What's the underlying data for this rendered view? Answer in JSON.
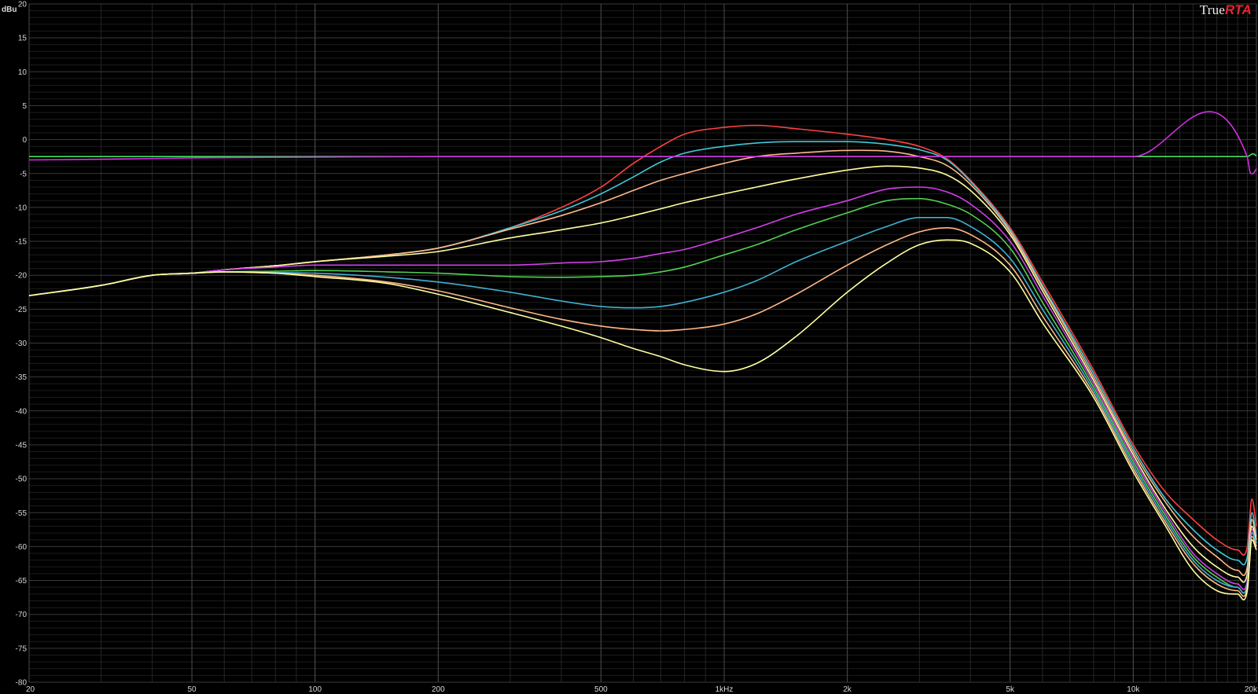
{
  "brand": {
    "prefix": "True",
    "accent": "RTA",
    "accent_color": "#e8232a"
  },
  "chart_data": {
    "type": "line",
    "ylabel": "dBu",
    "xscale": "log",
    "xlim": [
      20,
      20000
    ],
    "ylim": [
      -80,
      20
    ],
    "grid": true,
    "background": "#000000",
    "yticks": [
      20,
      15,
      10,
      5,
      0,
      -5,
      -10,
      -15,
      -20,
      -25,
      -30,
      -35,
      -40,
      -45,
      -50,
      -55,
      -60,
      -65,
      -70,
      -75,
      -80
    ],
    "xticks": [
      {
        "value": 20,
        "label": "20"
      },
      {
        "value": 50,
        "label": "50"
      },
      {
        "value": 100,
        "label": "100"
      },
      {
        "value": 200,
        "label": "200"
      },
      {
        "value": 500,
        "label": "500"
      },
      {
        "value": 1000,
        "label": "1kHz"
      },
      {
        "value": 2000,
        "label": "2k"
      },
      {
        "value": 5000,
        "label": "5k"
      },
      {
        "value": 10000,
        "label": "10k"
      },
      {
        "value": 20000,
        "label": "20k"
      }
    ],
    "series": [
      {
        "color": "#ff4040",
        "x": [
          20,
          30,
          40,
          50,
          60,
          80,
          100,
          150,
          200,
          300,
          400,
          500,
          600,
          700,
          800,
          1000,
          1200,
          1500,
          2000,
          2500,
          3000,
          3500,
          4000,
          5000,
          6000,
          8000,
          10000,
          12000,
          14000,
          16000,
          18000,
          19000,
          19500,
          20000
        ],
        "y": [
          -23,
          -21.5,
          -20,
          -19.7,
          -19.2,
          -18.6,
          -18,
          -17,
          -16,
          -13,
          -10,
          -7,
          -3.5,
          -1,
          0.8,
          1.8,
          2.1,
          1.6,
          0.8,
          0,
          -1,
          -2.8,
          -6,
          -13,
          -21,
          -34,
          -45,
          -52,
          -56,
          -59,
          -60.5,
          -60,
          -53,
          -57
        ]
      },
      {
        "color": "#40c8d8",
        "x": [
          20,
          30,
          40,
          50,
          60,
          80,
          100,
          150,
          200,
          300,
          400,
          500,
          600,
          700,
          800,
          1000,
          1200,
          1500,
          2000,
          2500,
          3000,
          3500,
          4000,
          5000,
          6000,
          8000,
          10000,
          12000,
          14000,
          16000,
          18000,
          19000,
          19500,
          20000
        ],
        "y": [
          -23,
          -21.5,
          -20,
          -19.7,
          -19.2,
          -18.6,
          -18,
          -17,
          -16,
          -13,
          -10.5,
          -8,
          -5.5,
          -3.3,
          -2,
          -1,
          -0.5,
          -0.3,
          -0.3,
          -0.7,
          -1.5,
          -3,
          -6.2,
          -13.3,
          -21.5,
          -34.5,
          -45.5,
          -53,
          -57.5,
          -60.5,
          -62,
          -61.5,
          -55,
          -58.5
        ]
      },
      {
        "color": "#ffb888",
        "x": [
          20,
          30,
          40,
          50,
          60,
          80,
          100,
          150,
          200,
          300,
          400,
          500,
          600,
          700,
          800,
          1000,
          1200,
          1500,
          2000,
          2500,
          3000,
          3500,
          4000,
          5000,
          6000,
          8000,
          10000,
          12000,
          14000,
          16000,
          18000,
          19000,
          19500,
          20000
        ],
        "y": [
          -23,
          -21.5,
          -20,
          -19.7,
          -19.2,
          -18.6,
          -18,
          -17,
          -16,
          -13.2,
          -11.2,
          -9.3,
          -7.5,
          -6,
          -5,
          -3.5,
          -2.5,
          -2,
          -1.6,
          -1.7,
          -2.5,
          -3.8,
          -6.6,
          -13.6,
          -21.8,
          -35,
          -46,
          -53.5,
          -58.5,
          -61.5,
          -63.5,
          -63,
          -56,
          -59
        ]
      },
      {
        "color": "#ffffa0",
        "x": [
          20,
          30,
          40,
          50,
          60,
          80,
          100,
          150,
          200,
          300,
          400,
          500,
          600,
          700,
          800,
          1000,
          1200,
          1500,
          2000,
          2500,
          3000,
          3500,
          4000,
          5000,
          6000,
          8000,
          10000,
          12000,
          14000,
          16000,
          18000,
          19000,
          19500,
          20000
        ],
        "y": [
          -23,
          -21.5,
          -20,
          -19.7,
          -19.2,
          -18.6,
          -18,
          -17.2,
          -16.5,
          -14.5,
          -13.3,
          -12.3,
          -11.2,
          -10.2,
          -9.3,
          -8,
          -7,
          -5.8,
          -4.5,
          -3.9,
          -4.2,
          -5.2,
          -7.5,
          -14,
          -22.3,
          -35.5,
          -46.5,
          -54.5,
          -60,
          -63,
          -64.5,
          -64,
          -57,
          -59.5
        ]
      },
      {
        "color": "#d040e8",
        "x": [
          20,
          30,
          40,
          50,
          60,
          80,
          100,
          150,
          200,
          300,
          400,
          500,
          600,
          700,
          800,
          1000,
          1200,
          1500,
          2000,
          2500,
          3000,
          3500,
          4000,
          5000,
          6000,
          8000,
          10000,
          12000,
          14000,
          16000,
          18000,
          19000,
          19500,
          20000
        ],
        "y": [
          -23,
          -21.5,
          -20,
          -19.7,
          -19.2,
          -18.8,
          -18.5,
          -18.5,
          -18.5,
          -18.5,
          -18.2,
          -18,
          -17.5,
          -16.8,
          -16.2,
          -14.5,
          -13,
          -11,
          -9,
          -7.3,
          -7,
          -7.7,
          -9.5,
          -15,
          -23,
          -36,
          -47,
          -55,
          -61,
          -64,
          -65.5,
          -65,
          -57.5,
          -60
        ]
      },
      {
        "color": "#50d050",
        "x": [
          20,
          30,
          40,
          50,
          60,
          80,
          100,
          150,
          200,
          300,
          400,
          500,
          600,
          700,
          800,
          1000,
          1200,
          1500,
          2000,
          2500,
          3000,
          3500,
          4000,
          5000,
          6000,
          8000,
          10000,
          12000,
          14000,
          16000,
          18000,
          19000,
          19500,
          20000
        ],
        "y": [
          -23,
          -21.5,
          -20,
          -19.7,
          -19.5,
          -19.4,
          -19.3,
          -19.5,
          -19.7,
          -20.2,
          -20.3,
          -20.2,
          -20,
          -19.5,
          -18.8,
          -17,
          -15.5,
          -13.3,
          -10.8,
          -9,
          -8.7,
          -9.5,
          -11,
          -16,
          -24,
          -36.5,
          -47.5,
          -55.5,
          -61.5,
          -64.5,
          -66,
          -65.5,
          -58,
          -59.5
        ]
      },
      {
        "color": "#40b0d0",
        "x": [
          20,
          30,
          40,
          50,
          60,
          80,
          100,
          150,
          200,
          300,
          400,
          500,
          600,
          700,
          800,
          1000,
          1200,
          1500,
          2000,
          2500,
          3000,
          3500,
          4000,
          5000,
          6000,
          8000,
          10000,
          12000,
          14000,
          16000,
          18000,
          19000,
          19500,
          20000
        ],
        "y": [
          -23,
          -21.5,
          -20,
          -19.7,
          -19.5,
          -19.6,
          -19.7,
          -20.3,
          -21,
          -22.5,
          -23.8,
          -24.6,
          -24.8,
          -24.6,
          -24,
          -22.5,
          -20.8,
          -18,
          -15,
          -12.8,
          -11.5,
          -11.5,
          -12.8,
          -17.5,
          -25,
          -37,
          -48,
          -56,
          -62,
          -65,
          -66,
          -65.5,
          -58,
          -59.5
        ]
      },
      {
        "color": "#ffb888",
        "x": [
          20,
          30,
          40,
          50,
          60,
          80,
          100,
          150,
          200,
          300,
          400,
          500,
          600,
          700,
          800,
          1000,
          1200,
          1500,
          2000,
          2500,
          3000,
          3500,
          4000,
          5000,
          6000,
          8000,
          10000,
          12000,
          14000,
          16000,
          18000,
          19000,
          19500,
          20000
        ],
        "y": [
          -23,
          -21.5,
          -20,
          -19.7,
          -19.5,
          -19.7,
          -20,
          -21,
          -22.3,
          -24.8,
          -26.5,
          -27.5,
          -28,
          -28.2,
          -28,
          -27.2,
          -25.7,
          -22.8,
          -18.5,
          -15.5,
          -13.6,
          -13,
          -14,
          -18.5,
          -26,
          -37.5,
          -48.5,
          -56.5,
          -62.5,
          -65.5,
          -66.5,
          -66,
          -58.5,
          -60
        ]
      },
      {
        "color": "#ffffa0",
        "x": [
          20,
          30,
          40,
          50,
          60,
          80,
          100,
          150,
          200,
          300,
          400,
          500,
          600,
          700,
          800,
          1000,
          1200,
          1500,
          2000,
          2500,
          3000,
          3500,
          4000,
          5000,
          6000,
          8000,
          10000,
          12000,
          14000,
          16000,
          18000,
          19000,
          19500,
          20000
        ],
        "y": [
          -23,
          -21.5,
          -20,
          -19.7,
          -19.5,
          -19.7,
          -20.2,
          -21.2,
          -22.8,
          -25.5,
          -27.5,
          -29.2,
          -30.8,
          -32,
          -33.2,
          -34.2,
          -33,
          -29,
          -22.5,
          -18.2,
          -15.5,
          -14.8,
          -15.3,
          -19.5,
          -27,
          -38,
          -49,
          -57,
          -63.5,
          -66.5,
          -67,
          -66.5,
          -59,
          -60.5
        ]
      },
      {
        "color": "#40e060",
        "x": [
          20,
          100,
          200,
          500,
          1000,
          2000,
          5000,
          10000,
          19000,
          19300,
          19600,
          20000
        ],
        "y": [
          -2.5,
          -2.5,
          -2.5,
          -2.5,
          -2.5,
          -2.5,
          -2.5,
          -2.5,
          -2.5,
          -2.3,
          -2.1,
          -2.4
        ]
      },
      {
        "color": "#d030e0",
        "x": [
          20,
          30,
          50,
          100,
          200,
          500,
          1000,
          2000,
          5000,
          10000,
          19000,
          19300,
          19600,
          20000
        ],
        "y": [
          -3,
          -2.9,
          -2.7,
          -2.6,
          -2.5,
          -2.5,
          -2.5,
          -2.5,
          -2.5,
          -2.5,
          -2.6,
          -4.8,
          -5,
          -4.3
        ]
      }
    ]
  }
}
